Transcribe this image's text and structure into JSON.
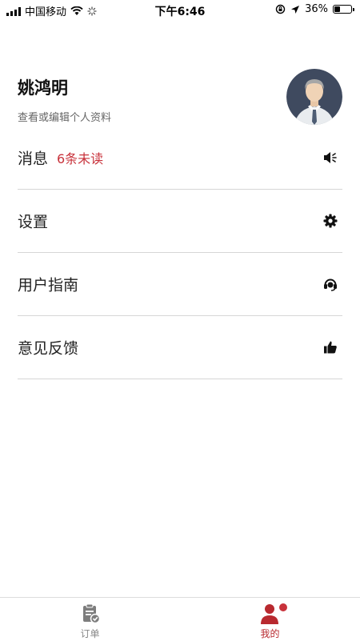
{
  "status_bar": {
    "carrier": "中国移动",
    "time": "下午6:46",
    "battery": "36%",
    "battery_level": 0.36
  },
  "profile": {
    "name": "姚鸿明",
    "subtitle": "查看或编辑个人资料"
  },
  "menu": [
    {
      "label": "消息",
      "badge": "6条未读",
      "icon": "speaker-icon"
    },
    {
      "label": "设置",
      "icon": "gear-icon"
    },
    {
      "label": "用户指南",
      "icon": "headset-icon"
    },
    {
      "label": "意见反馈",
      "icon": "thumbs-up-icon"
    }
  ],
  "tabs": [
    {
      "label": "订单",
      "icon": "clipboard-check-icon",
      "active": false
    },
    {
      "label": "我的",
      "icon": "user-profile-icon",
      "active": true
    }
  ],
  "colors": {
    "accent": "#c8323b",
    "tab_active": "#b8292f",
    "tab_inactive": "#888888",
    "divider": "#d6d6d6"
  }
}
